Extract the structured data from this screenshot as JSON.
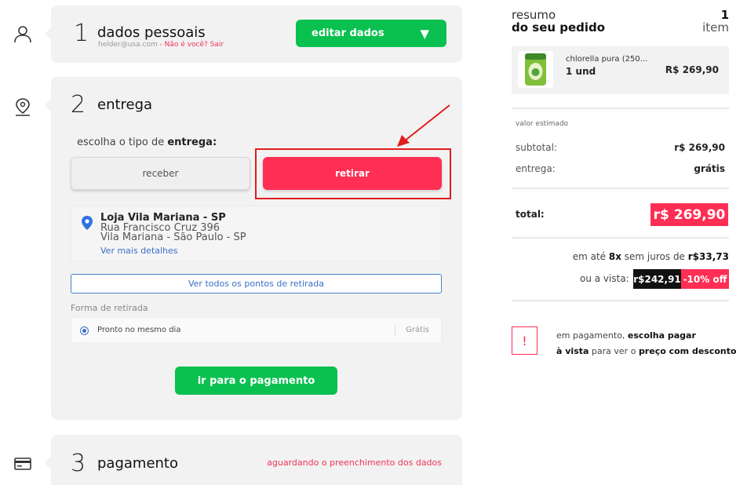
{
  "steps": {
    "personal": {
      "number": "1",
      "title": "dados pessoais",
      "email": "helder@usa.com",
      "not_you": " - Não é você? Sair",
      "edit_button": "editar dados",
      "edit_arrow": "▼"
    },
    "delivery": {
      "number": "2",
      "title": "entrega",
      "choose_prefix": "escolha o tipo de",
      "choose_bold": "entrega:",
      "option_receive": "receber",
      "option_pickup": "retirar",
      "store": {
        "name": "Loja Vila Mariana - SP",
        "street": "Rua Francisco Cruz 396",
        "city": "Vila Mariana - São Paulo - SP",
        "details_link": "Ver mais detalhes"
      },
      "all_points_button": "Ver todos os pontos de retirada",
      "pickup_form_label": "Forma de retirada",
      "pickup_option": "Pronto no mesmo dia",
      "pickup_price": "Grátis",
      "go_payment_button": "ir para o pagamento"
    },
    "payment": {
      "number": "3",
      "title": "pagamento",
      "status": "aguardando o preenchimento dos dados"
    }
  },
  "summary": {
    "title_line1": "resumo",
    "title_line2": "do seu pedido",
    "count": "1",
    "count_label": "item",
    "product": {
      "name": "chlorella pura (250...",
      "qty": "1 und",
      "price": "R$ 269,90"
    },
    "estimated_label": "valor estimado",
    "subtotal_label": "subtotal:",
    "subtotal_value": "r$ 269,90",
    "shipping_label": "entrega:",
    "shipping_value": "grátis",
    "total_label": "total:",
    "total_value": "r$ 269,90",
    "installments_prefix": "em até",
    "installments_count": "8x",
    "installments_middle": "sem juros de",
    "installments_value": "r$33,73",
    "cash_label": "ou a vista:",
    "cash_price": "r$242,91",
    "cash_discount": "-10% off",
    "notice_icon": "!",
    "notice_line1_a": "em pagamento,",
    "notice_line1_b": "escolha pagar",
    "notice_line2_a": "à vista",
    "notice_line2_b": "para ver o",
    "notice_line2_c": "preço com desconto"
  },
  "icons": [
    "user-icon",
    "location-pin-icon",
    "credit-card-icon",
    "map-marker-icon",
    "radio-selected-icon",
    "alert-icon"
  ],
  "colors": {
    "green": "#0ac04f",
    "red": "#ff2e54",
    "link_blue": "#3b6fc7",
    "card_bg": "#f2f2f2"
  }
}
